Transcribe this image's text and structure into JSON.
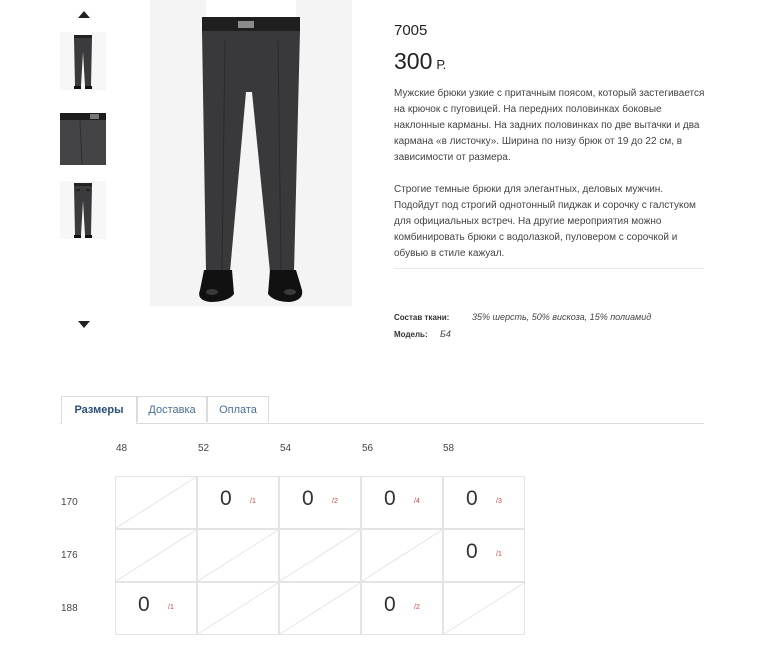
{
  "gallery": {
    "thumbnails": [
      "thumb-full-front",
      "thumb-waist-detail",
      "thumb-full-back"
    ]
  },
  "product": {
    "code": "7005",
    "price": "300",
    "currency": "Р.",
    "description": [
      "Мужские брюки узкие с притачным поясом, который застегивается на крючок с пуговицей. На передних половинках боковые наклонные карманы. На задних половинках по две вытачки и два кармана «в листочку». Ширина по низу брюк от 19 до 22 см, в зависимости от размера.",
      "Строгие темные брюки для элегантных, деловых мужчин. Подойдут под строгий однотонный пиджак и сорочку с галстуком для официальных встреч. На другие мероприятия можно комбинировать брюки с водолазкой, пуловером с сорочкой и обувью в стиле кажуал."
    ],
    "specs": {
      "fabric_label": "Состав ткани:",
      "fabric_value": "35% шерсть, 50% вискоза, 15% полиамид",
      "model_label": "Модель:",
      "model_value": "Б4"
    }
  },
  "tabs": [
    "Размеры",
    "Доставка",
    "Оплата"
  ],
  "size_table": {
    "columns": [
      "48",
      "52",
      "54",
      "56",
      "58"
    ],
    "rows": [
      "170",
      "176",
      "188"
    ],
    "cells": [
      [
        null,
        {
          "qty": "0",
          "sub": "/1"
        },
        {
          "qty": "0",
          "sub": "/2"
        },
        {
          "qty": "0",
          "sub": "/4"
        },
        {
          "qty": "0",
          "sub": "/3"
        }
      ],
      [
        null,
        null,
        null,
        null,
        {
          "qty": "0",
          "sub": "/1"
        }
      ],
      [
        {
          "qty": "0",
          "sub": "/1"
        },
        null,
        null,
        {
          "qty": "0",
          "sub": "/2"
        },
        null
      ]
    ]
  }
}
